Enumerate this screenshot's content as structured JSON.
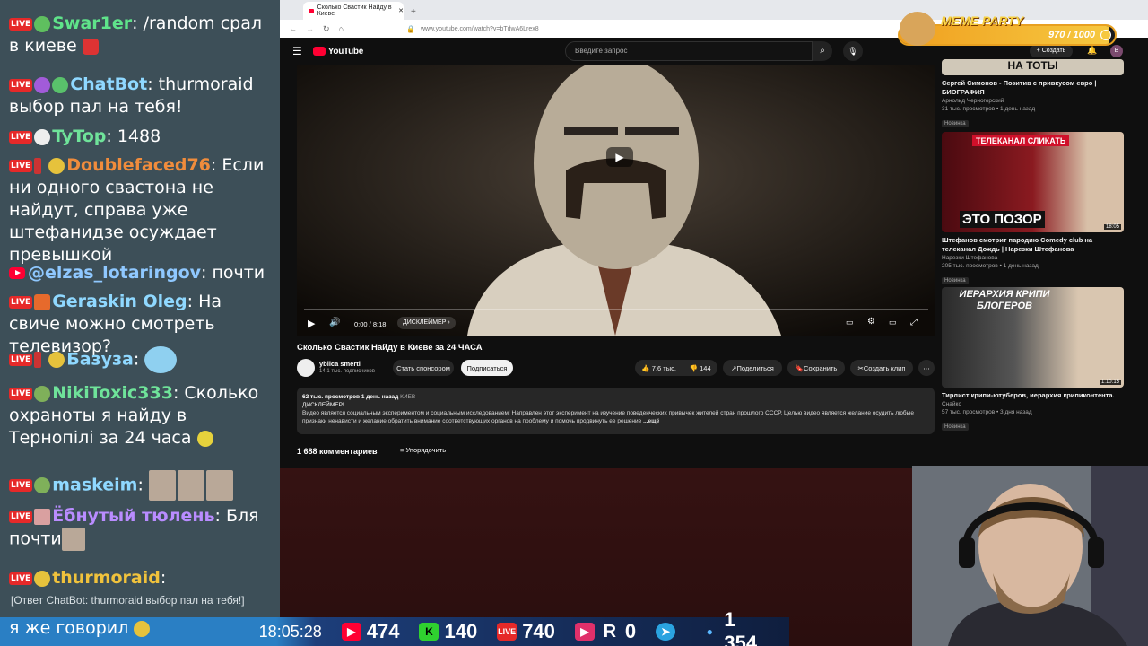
{
  "chat": {
    "messages": [
      {
        "nick": "Swar1er",
        "nick_color": "#5fe38a",
        "text": "/random срал в киеве",
        "platform": "live"
      },
      {
        "nick": "ChatBot",
        "nick_color": "#8fd8ff",
        "text": "thurmoraid выбор пал на тебя!",
        "platform": "live"
      },
      {
        "nick": "TyTop",
        "nick_color": "#6fe39a",
        "text": "1488",
        "platform": "live"
      },
      {
        "nick": "Doublefaced76",
        "nick_color": "#f08c3c",
        "text": "Если ни одного свастона не найдут, справа уже штефанидзе осуждает превышкой",
        "platform": "live"
      },
      {
        "nick": "@elzas_lotaringov",
        "nick_color": "#8fc8ff",
        "text": "почти",
        "platform": "youtube"
      },
      {
        "nick": "Geraskin Oleg",
        "nick_color": "#8fd8ff",
        "text": "На свиче можно смотреть телевизор?",
        "platform": "live"
      },
      {
        "nick": "Базуза",
        "nick_color": "#8fd8ff",
        "text": "",
        "platform": "live"
      },
      {
        "nick": "NikiToxic333",
        "nick_color": "#6fe39a",
        "text": "Сколько охраноты я найду в Тернопілі за 24 часа",
        "platform": "live"
      },
      {
        "nick": "maskeim",
        "nick_color": "#8fd8ff",
        "text": "",
        "platform": "live"
      },
      {
        "nick": "Ёбнутый тюлень",
        "nick_color": "#b98cff",
        "text": "Бля почти",
        "platform": "live"
      },
      {
        "nick": "thurmoraid",
        "nick_color": "#f0c23c",
        "text": "",
        "platform": "live"
      }
    ],
    "reply_text": "[Ответ ChatBot: thurmoraid выбор пал на тебя!]",
    "last_text": "я же говорил",
    "live_label": "LIVE"
  },
  "stats": {
    "time": "18:05:28",
    "youtube": "474",
    "kick": "140",
    "live": "740",
    "rumble": "0",
    "telegram": "",
    "viewers": "1 354",
    "r_label": "R"
  },
  "browser": {
    "tab_title": "Сколько Свастик Найду в Киеве",
    "url": "www.youtube.com/watch?v=bTdwA6Lrex8"
  },
  "youtube": {
    "logo": "YouTube",
    "search_placeholder": "Введите запрос",
    "create_label": "Создать",
    "video_title": "Сколько Свастик Найду в Киеве за 24 ЧАСА",
    "channel_name": "ybilca smerti",
    "subscribers": "14,1 тыс. подписчиков",
    "sponsor_label": "Стать спонсором",
    "subscribe_label": "Подписаться",
    "likes": "7,6 тыс.",
    "dislikes": "144",
    "share_label": "Поделиться",
    "save_label": "Сохранить",
    "clip_label": "Создать клип",
    "time_display": "0:00 / 8:18",
    "chapter_label": "ДИСКЛЕЙМЕР",
    "views_line": "62 тыс. просмотров  1 день назад",
    "tag": "КИЕВ",
    "desc_title": "ДИСКЛЕЙМЕР!",
    "desc_text": "Видео является социальным экспериментом и социальным исследованием! Направлен этот эксперимент на изучение поведенческих привычек жителей стран прошлого СССР. Целью видео является желание осудить любые признаки ненависти и желание обратить внимание соответствующих органов на проблему и помочь продвинуть ее решение",
    "more_label": "...ещё",
    "comments_count": "1 688 комментариев",
    "sort_label": "Упорядочить"
  },
  "sidebar": {
    "videos": [
      {
        "title": "Сергей Симонов - Позитив с привкусом евро | БИОГРАФИЯ",
        "channel": "Арнольд Черногорский",
        "meta": "31 тыс. просмотров • 1 день назад",
        "badge": "Новинка",
        "thumb_text": "НА ТОТЫ"
      },
      {
        "title": "Штефанов смотрит пародию Comedy club на телеканал Дождь | Нарезки Штефанова",
        "channel": "Нарезки Штефанова",
        "meta": "205 тыс. просмотров • 1 день назад",
        "badge": "Новинка",
        "thumb_text": "ЭТО ПОЗОР",
        "duration": "18:05",
        "top_text": "ТЕЛЕКАНАЛ СЛИКАТЬ"
      },
      {
        "title": "Тирлист крипи-ютуберов, иерархия крипиконтента.",
        "channel": "Снайкс",
        "meta": "57 тыс. просмотров • 3 дня назад",
        "badge": "Новинка",
        "thumb_text": "ИЕРАРХИЯ КРИПИ БЛОГЕРОВ",
        "duration": "1:10:15"
      }
    ]
  },
  "meme": {
    "label": "MEME PARTY",
    "progress_text": "970 / 1000",
    "progress": 0.97
  }
}
